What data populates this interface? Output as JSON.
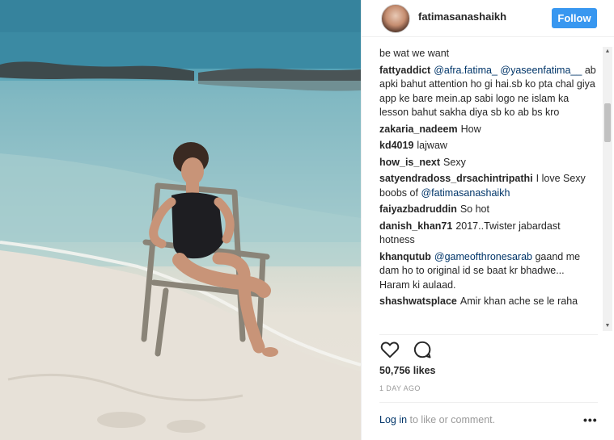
{
  "post": {
    "username": "fatimasanashaikh",
    "follow_label": "Follow",
    "likes": "50,756 likes",
    "time_ago": "1 DAY AGO",
    "login_link": "Log in",
    "login_suffix": " to like or comment.",
    "more_label": "•••"
  },
  "comments": [
    {
      "user": "",
      "parts": [
        {
          "t": "be wat we want"
        }
      ]
    },
    {
      "user": "fattyaddict",
      "parts": [
        {
          "t": "@afra.fatima_",
          "m": true
        },
        {
          "t": " "
        },
        {
          "t": "@yaseenfatima__",
          "m": true
        },
        {
          "t": " ab apki bahut attention ho gi hai.sb ko pta chal giya app ke bare mein.ap sabi logo ne islam ka lesson bahut sakha diya sb ko ab bs kro"
        }
      ]
    },
    {
      "user": "zakaria_nadeem",
      "parts": [
        {
          "t": "How"
        }
      ]
    },
    {
      "user": "kd4019",
      "parts": [
        {
          "t": "lajwaw"
        }
      ]
    },
    {
      "user": "how_is_next",
      "parts": [
        {
          "t": "Sexy"
        }
      ]
    },
    {
      "user": "satyendradoss_drsachintripathi",
      "parts": [
        {
          "t": "I love Sexy boobs of "
        },
        {
          "t": "@fatimasanashaikh",
          "m": true
        }
      ]
    },
    {
      "user": "faiyazbadruddin",
      "parts": [
        {
          "t": "So hot"
        }
      ]
    },
    {
      "user": "danish_khan71",
      "parts": [
        {
          "t": "2017..Twister jabardast hotness"
        }
      ]
    },
    {
      "user": "khanqutub",
      "parts": [
        {
          "t": "@gameofthronesarab",
          "m": true
        },
        {
          "t": " gaand me dam ho to original id se baat kr bhadwe... Haram ki aulaad."
        }
      ]
    },
    {
      "user": "shashwatsplace",
      "parts": [
        {
          "t": "Amir khan ache se le raha"
        }
      ]
    }
  ],
  "icons": {
    "like": "heart-icon",
    "comment": "comment-icon",
    "more": "more-options-icon"
  },
  "colors": {
    "follow_button": "#3897f0",
    "mention": "#003569",
    "muted": "#999999"
  }
}
